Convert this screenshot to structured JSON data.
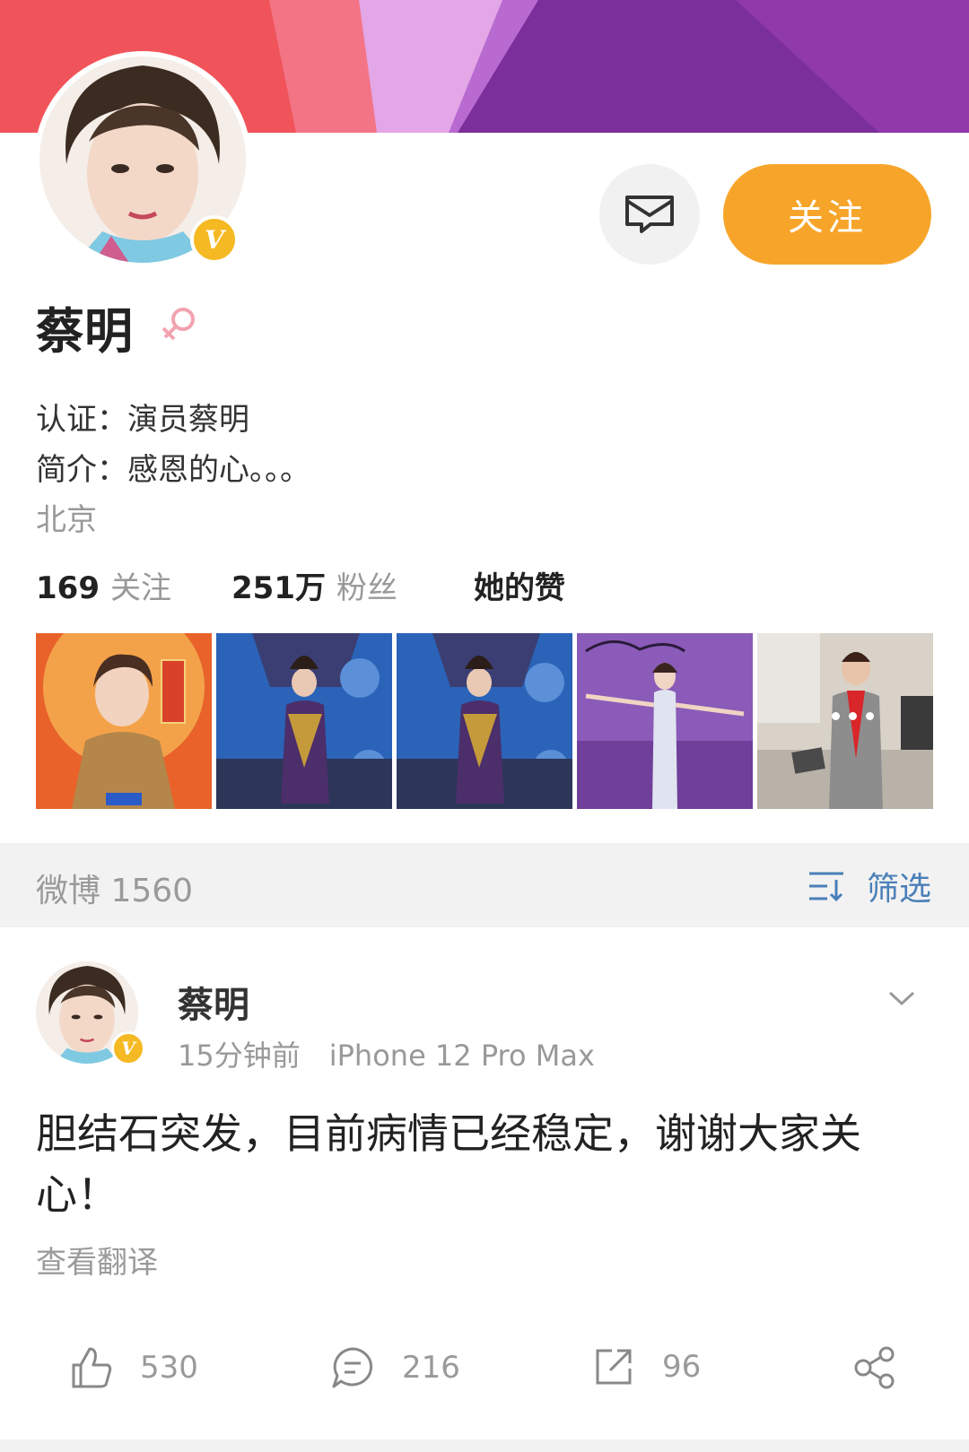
{
  "profile": {
    "name": "蔡明",
    "verified_badge": "V",
    "verification": "认证：演员蔡明",
    "bio": "简介：感恩的心。。。",
    "location": "北京",
    "follow_label": "关注",
    "message_icon": "message-icon",
    "gender_icon": "female-icon"
  },
  "stats": {
    "following_count": "169",
    "following_label": "关注",
    "followers_count": "251万",
    "followers_label": "粉丝",
    "likes_label": "她的赞"
  },
  "weibo_bar": {
    "count_text": "微博 1560",
    "filter_label": "筛选"
  },
  "post": {
    "author": "蔡明",
    "time": "15分钟前",
    "source": "iPhone 12 Pro Max",
    "text": "胆结石突发，目前病情已经稳定，谢谢大家关心！",
    "translate_label": "查看翻译",
    "likes": "530",
    "comments": "216",
    "reposts": "96"
  },
  "colors": {
    "follow_button": "#f7a52a",
    "verified_badge": "#f5b923",
    "link_blue": "#4a7fb8",
    "muted_text": "#999999"
  }
}
